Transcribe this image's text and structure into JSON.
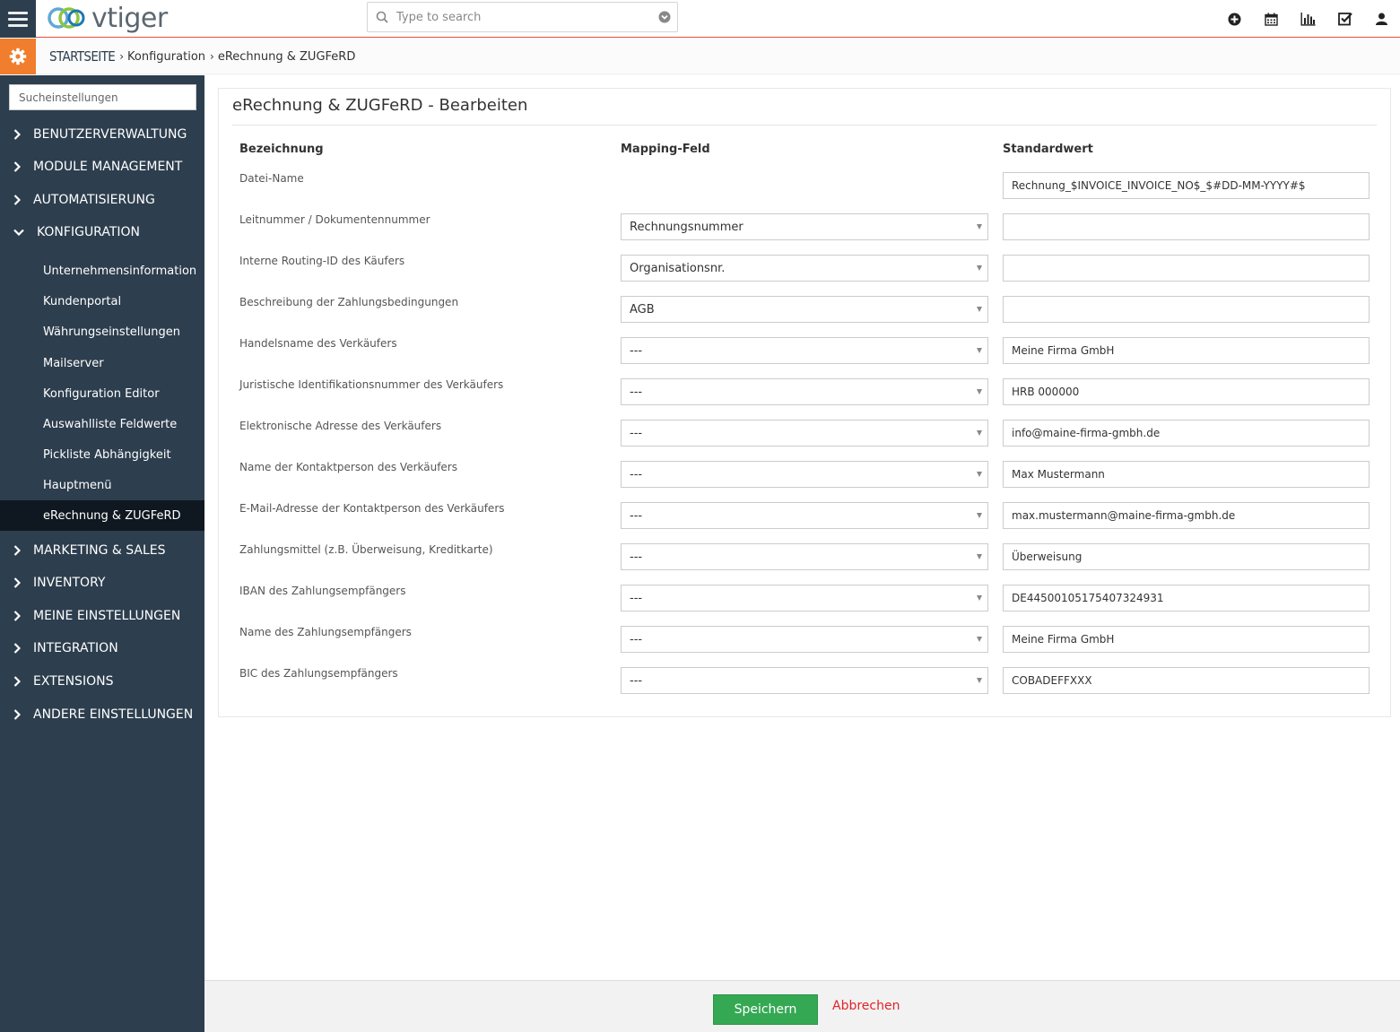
{
  "app": {
    "logo_text": "vtiger"
  },
  "search": {
    "placeholder": "Type to search"
  },
  "top_icons": [
    "plus-circle-icon",
    "calendar-icon",
    "bar-chart-icon",
    "checkbox-icon",
    "user-icon"
  ],
  "breadcrumb": {
    "home": "STARTSEITE",
    "level1": "Konfiguration",
    "level2": "eRechnung & ZUGFeRD"
  },
  "sidebar": {
    "search_placeholder": "Sucheinstellungen",
    "sections": [
      {
        "label": "BENUTZERVERWALTUNG"
      },
      {
        "label": "MODULE MANAGEMENT"
      },
      {
        "label": "AUTOMATISIERUNG"
      },
      {
        "label": "KONFIGURATION"
      },
      {
        "label": "MARKETING & SALES"
      },
      {
        "label": "INVENTORY"
      },
      {
        "label": "MEINE EINSTELLUNGEN"
      },
      {
        "label": "INTEGRATION"
      },
      {
        "label": "EXTENSIONS"
      },
      {
        "label": "ANDERE EINSTELLUNGEN"
      }
    ],
    "config_items": [
      {
        "label": "Unternehmensinformation"
      },
      {
        "label": "Kundenportal"
      },
      {
        "label": "Währungseinstellungen"
      },
      {
        "label": "Mailserver"
      },
      {
        "label": "Konfiguration Editor"
      },
      {
        "label": "Auswahlliste Feldwerte"
      },
      {
        "label": "Pickliste Abhängigkeit"
      },
      {
        "label": "Hauptmenü"
      },
      {
        "label": "eRechnung & ZUGFeRD"
      }
    ]
  },
  "panel": {
    "title": "eRechnung & ZUGFeRD - Bearbeiten",
    "col_label": "Bezeichnung",
    "col_mapping": "Mapping-Feld",
    "col_default": "Standardwert",
    "rows": [
      {
        "label": "Datei-Name",
        "mapping": null,
        "default": "Rechnung_$INVOICE_INVOICE_NO$_$#DD-MM-YYYY#$"
      },
      {
        "label": "Leitnummer / Dokumentennummer",
        "mapping": "Rechnungsnummer",
        "default": ""
      },
      {
        "label": "Interne Routing-ID des Käufers",
        "mapping": "Organisationsnr.",
        "default": ""
      },
      {
        "label": "Beschreibung der Zahlungsbedingungen",
        "mapping": "AGB",
        "default": ""
      },
      {
        "label": "Handelsname des Verkäufers",
        "mapping": "---",
        "default": "Meine Firma GmbH"
      },
      {
        "label": "Juristische Identifikationsnummer des Verkäufers",
        "mapping": "---",
        "default": "HRB 000000"
      },
      {
        "label": "Elektronische Adresse des Verkäufers",
        "mapping": "---",
        "default": "info@maine-firma-gmbh.de"
      },
      {
        "label": "Name der Kontaktperson des Verkäufers",
        "mapping": "---",
        "default": "Max Mustermann"
      },
      {
        "label": "E-Mail-Adresse der Kontaktperson des Verkäufers",
        "mapping": "---",
        "default": "max.mustermann@maine-firma-gmbh.de"
      },
      {
        "label": "Zahlungsmittel (z.B. Überweisung, Kreditkarte)",
        "mapping": "---",
        "default": "Überweisung"
      },
      {
        "label": "IBAN des Zahlungsempfängers",
        "mapping": "---",
        "default": "DE44500105175407324931"
      },
      {
        "label": "Name des Zahlungsempfängers",
        "mapping": "---",
        "default": "Meine Firma GmbH"
      },
      {
        "label": "BIC des Zahlungsempfängers",
        "mapping": "---",
        "default": "COBADEFFXXX"
      }
    ]
  },
  "footer": {
    "save_label": "Speichern",
    "cancel_label": "Abbrechen"
  },
  "colors": {
    "sidebar_bg": "#2d3e4e",
    "accent_orange": "#f07e2d",
    "save_green": "#35a853",
    "cancel_red": "#e0242a",
    "active_item_bg": "#0f1820"
  }
}
